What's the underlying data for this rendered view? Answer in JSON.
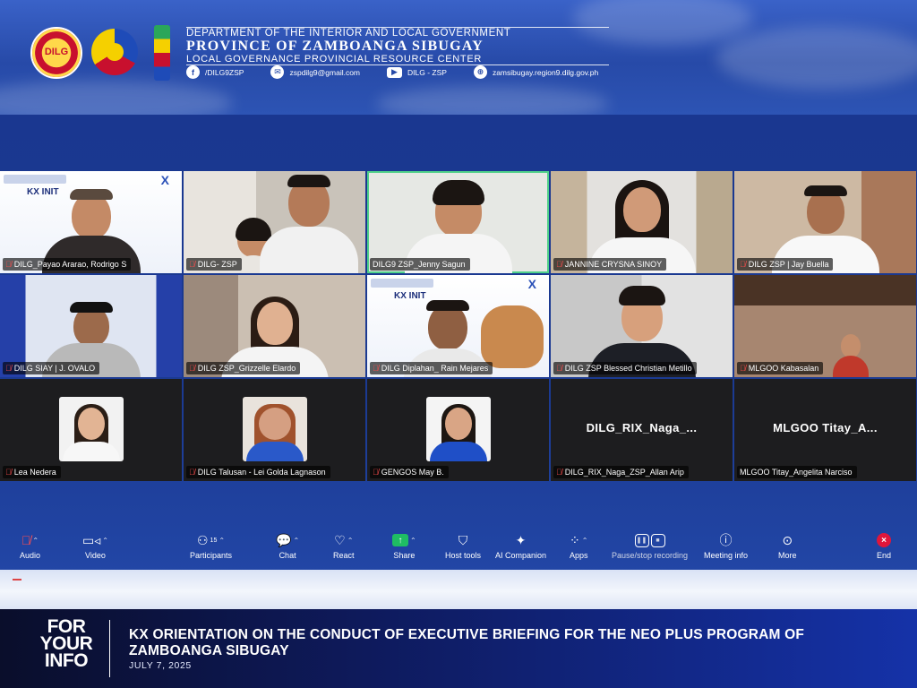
{
  "header": {
    "department": "DEPARTMENT OF THE INTERIOR AND LOCAL GOVERNMENT",
    "province": "PROVINCE OF ZAMBOANGA SIBUGAY",
    "center": "LOCAL GOVERNANCE PROVINCIAL RESOURCE CENTER",
    "dilg_seal_text": "DILG",
    "contacts": [
      {
        "icon": "facebook-icon",
        "text": "/DILG9ZSP"
      },
      {
        "icon": "email-icon",
        "text": "zspdilg9@gmail.com"
      },
      {
        "icon": "youtube-icon",
        "text": "DILG - ZSP"
      },
      {
        "icon": "globe-icon",
        "text": "zamsibugay.region9.dilg.gov.ph"
      }
    ]
  },
  "slide": {
    "title": "KX INIT",
    "logo": "X"
  },
  "participants": [
    {
      "name": "DILG_Payao Ararao, Rodrigo S",
      "muted": true
    },
    {
      "name": "DILG- ZSP",
      "muted": true
    },
    {
      "name": "DILG9 ZSP_Jenny Sagun",
      "muted": false,
      "active": true
    },
    {
      "name": "JANNINE CRYSNA SINOY",
      "muted": true
    },
    {
      "name": "DILG ZSP | Jay Buella",
      "muted": true
    },
    {
      "name": "DILG SIAY | J. OVALO",
      "muted": true
    },
    {
      "name": "DILG ZSP_Grizzelle Elardo",
      "muted": true
    },
    {
      "name": "DILG Diplahan_ Rain Mejares",
      "muted": true
    },
    {
      "name": "DILG ZSP Blessed Christian Metillo",
      "muted": true
    },
    {
      "name": "MLGOO Kabasalan",
      "muted": true
    },
    {
      "name": "Lea Nedera",
      "muted": true
    },
    {
      "name": "DILG Talusan - Lei Golda Lagnason",
      "muted": true
    },
    {
      "name": "GENGOS May B.",
      "muted": true
    },
    {
      "name": "DILG_RIX_Naga_ZSP_Allan Arip",
      "muted": true,
      "display": "DILG_RIX_Naga_..."
    },
    {
      "name": "MLGOO Titay_Angelita Narciso",
      "muted": false,
      "display": "MLGOO  Titay_A..."
    }
  ],
  "toolbar": {
    "audio": "Audio",
    "video": "Video",
    "participants": "Participants",
    "participants_count": "15",
    "chat": "Chat",
    "react": "React",
    "share": "Share",
    "host_tools": "Host tools",
    "ai_companion": "AI Companion",
    "apps": "Apps",
    "recording": "Pause/stop recording",
    "meeting_info": "Meeting info",
    "more": "More",
    "end": "End"
  },
  "footer": {
    "fyi": [
      "FOR",
      "YOUR",
      "INFO"
    ],
    "headline": "KX ORIENTATION ON THE CONDUCT OF EXECUTIVE BRIEFING FOR THE NEO PLUS PROGRAM OF ZAMBOANGA SIBUGAY",
    "date": "JULY 7, 2025"
  },
  "colors": {
    "banner": "#274aa8",
    "active_speaker": "#4fd08a",
    "share": "#1fbd63",
    "end": "#e0163b",
    "muted_mic": "#ff4d4d"
  }
}
